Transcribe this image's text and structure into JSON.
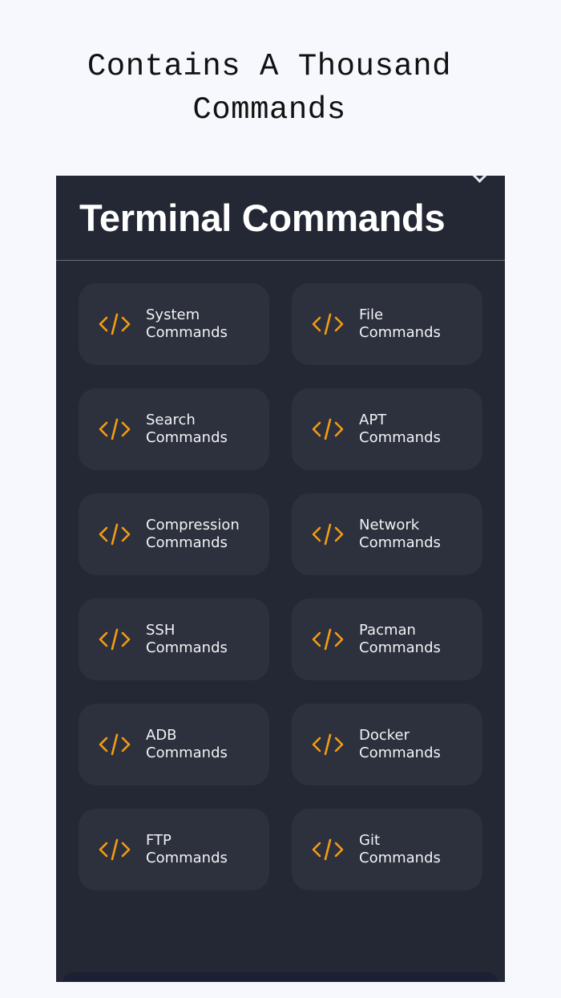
{
  "promo": {
    "caption": "Contains A Thousand\nCommands"
  },
  "screen": {
    "title": "Terminal Commands"
  },
  "commands": [
    {
      "line1": "System",
      "line2": "Commands"
    },
    {
      "line1": "File",
      "line2": "Commands"
    },
    {
      "line1": "Search",
      "line2": "Commands"
    },
    {
      "line1": "APT",
      "line2": "Commands"
    },
    {
      "line1": "Compression",
      "line2": "Commands"
    },
    {
      "line1": "Network",
      "line2": "Commands"
    },
    {
      "line1": "SSH",
      "line2": "Commands"
    },
    {
      "line1": "Pacman",
      "line2": "Commands"
    },
    {
      "line1": "ADB",
      "line2": "Commands"
    },
    {
      "line1": "Docker",
      "line2": "Commands"
    },
    {
      "line1": "FTP",
      "line2": "Commands"
    },
    {
      "line1": "Git Commands",
      "line2": ""
    }
  ],
  "icons": {
    "card_icon": "code-brackets-icon",
    "back_icon": "chevron-left-icon"
  },
  "colors": {
    "page_background": "#f7f8fd",
    "screen_background": "#242834",
    "card_background": "#2d303d",
    "accent": "#f39c12",
    "text": "#ffffff"
  }
}
